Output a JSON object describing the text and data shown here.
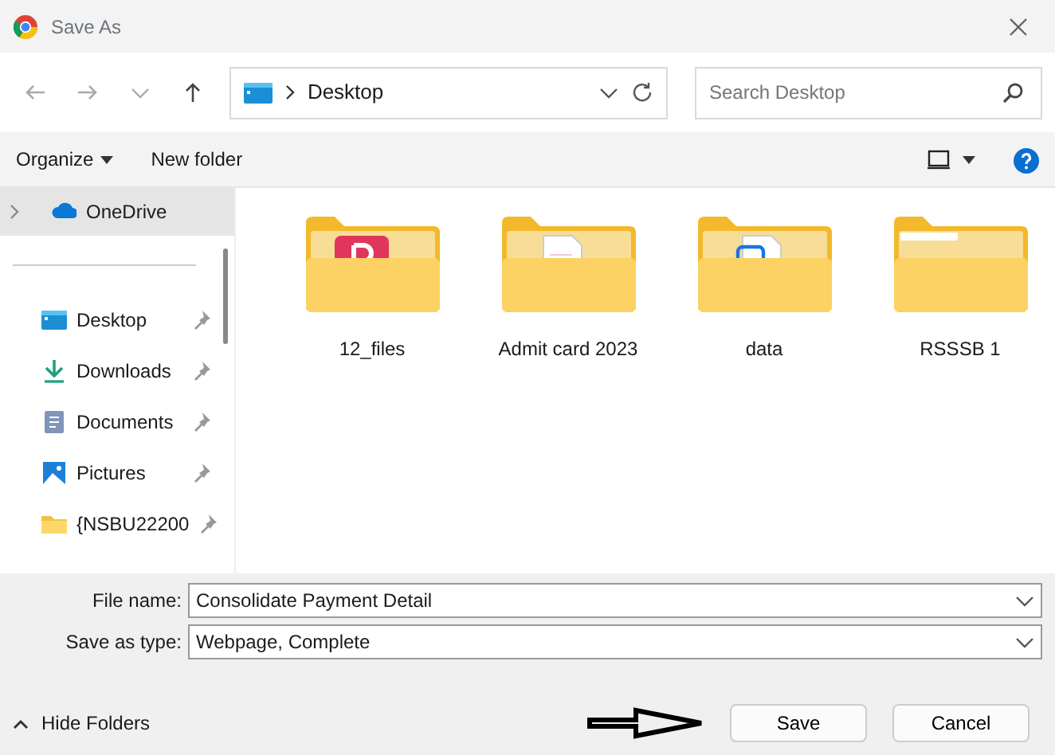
{
  "window": {
    "title": "Save As"
  },
  "address_bar": {
    "path": [
      "Desktop"
    ]
  },
  "search": {
    "placeholder": "Search Desktop"
  },
  "toolbar": {
    "organize": "Organize",
    "new_folder": "New folder"
  },
  "sidebar": {
    "items": [
      {
        "label": "OneDrive",
        "kind": "cloud",
        "selected": true,
        "pinned": false
      },
      {
        "label": "Desktop",
        "kind": "desktop",
        "selected": false,
        "pinned": true
      },
      {
        "label": "Downloads",
        "kind": "download",
        "selected": false,
        "pinned": true
      },
      {
        "label": "Documents",
        "kind": "document",
        "selected": false,
        "pinned": true
      },
      {
        "label": "Pictures",
        "kind": "picture",
        "selected": false,
        "pinned": true
      },
      {
        "label": "{NSBU22200",
        "kind": "folder",
        "selected": false,
        "pinned": true
      }
    ]
  },
  "folders": [
    {
      "name": "12_files",
      "kind": "app"
    },
    {
      "name": "Admit card 2023",
      "kind": "document"
    },
    {
      "name": "data",
      "kind": "chart"
    },
    {
      "name": "RSSSB 1",
      "kind": "empty"
    }
  ],
  "form": {
    "file_name_label": "File name:",
    "file_name": "Consolidate Payment Detail",
    "type_label": "Save as type:",
    "type": "Webpage, Complete"
  },
  "footer": {
    "hide_folders": "Hide Folders",
    "buttons": [
      "Save",
      "Cancel"
    ]
  }
}
